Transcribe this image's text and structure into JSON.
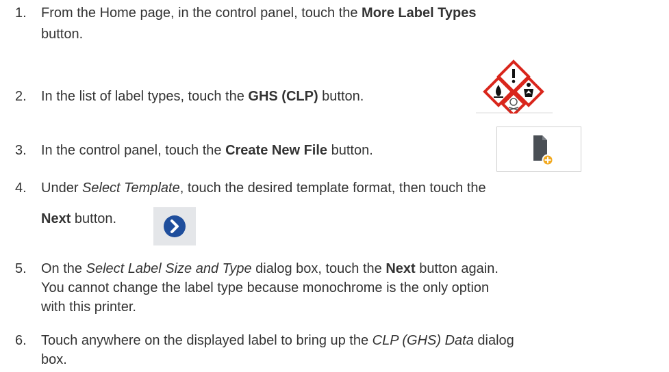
{
  "steps": [
    {
      "number": "1.",
      "line1": {
        "before": "From the Home page, in the control panel, touch the ",
        "bold": "More Label Types"
      },
      "line2": "button."
    },
    {
      "number": "2.",
      "before": "In the list of label types, touch the ",
      "bold": "GHS (CLP)",
      "after": " button.",
      "icon": "ghs-pictogram-icon"
    },
    {
      "number": "3.",
      "before": "In the control panel, touch the ",
      "bold": "Create New File",
      "after": " button.",
      "icon": "new-file-icon"
    },
    {
      "number": "4.",
      "line1": {
        "before": "Under ",
        "italic": "Select Template",
        "after": ", touch the desired template format, then touch the"
      },
      "line2": {
        "bold": "Next",
        "after": " button."
      },
      "icon": "next-arrow-icon"
    },
    {
      "number": "5.",
      "line1": {
        "before": "On the ",
        "italic": "Select Label Size and Type",
        "middle": " dialog box, touch the ",
        "bold": "Next",
        "after": " button again."
      },
      "line2": "You cannot change the label type because monochrome is the only option",
      "line3": "with this printer."
    },
    {
      "number": "6.",
      "line1": {
        "before": "Touch anywhere on the displayed label to bring up the ",
        "italic": "CLP (GHS) Data",
        "after": " dialog"
      },
      "line2": "box."
    }
  ],
  "colors": {
    "text": "#333333",
    "ghs_border": "#d9261c",
    "file_icon": "#4a4f55",
    "plus_badge": "#f2a91f",
    "next_button": "#1f4e9c"
  }
}
